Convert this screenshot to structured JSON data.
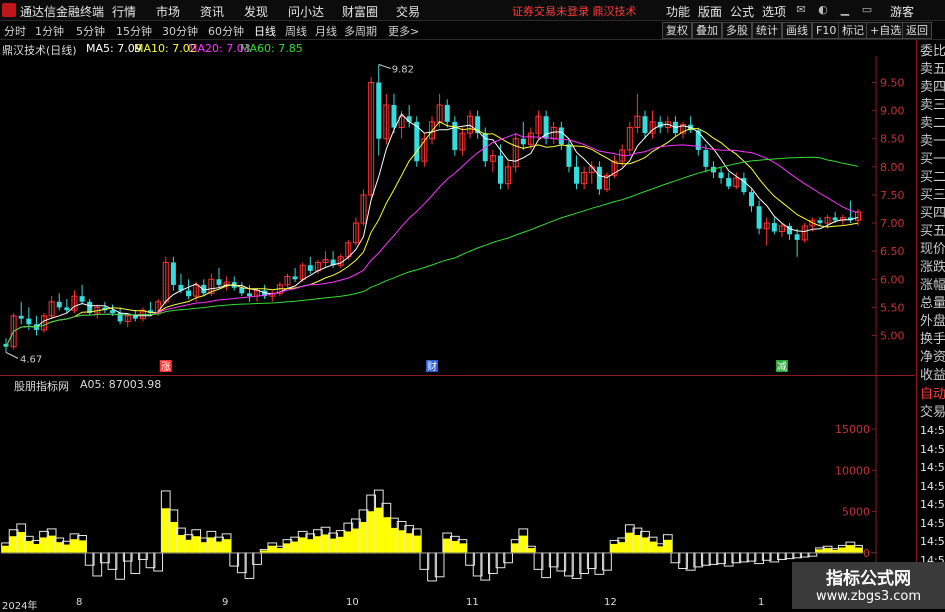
{
  "app": {
    "name": "通达信金融终端",
    "menu": [
      "行情",
      "市场",
      "资讯",
      "发现",
      "问小达",
      "财富圈",
      "交易"
    ],
    "notice": "证券交易未登录   鼎汉技术",
    "right_menu": [
      "功能",
      "版面",
      "公式",
      "选项"
    ],
    "guest": "游客"
  },
  "toolbar": {
    "periods": [
      "分时",
      "1分钟",
      "5分钟",
      "15分钟",
      "30分钟",
      "60分钟",
      "日线",
      "周线",
      "月线",
      "多周期",
      "更多>"
    ],
    "active_period": "日线",
    "buttons": [
      "复权",
      "叠加",
      "多股",
      "统计",
      "画线",
      "F10",
      "标记",
      "+自选",
      "返回"
    ]
  },
  "main_chart": {
    "title": "鼎汉技术(日线)",
    "ma": [
      {
        "label": "MA5: 7.09",
        "color": "#ffffff"
      },
      {
        "label": "MA10: 7.02",
        "color": "#ffff33"
      },
      {
        "label": "MA20: 7.03",
        "color": "#ff33ff"
      },
      {
        "label": "MA60: 7.85",
        "color": "#33dd33"
      }
    ],
    "high_label": "9.82",
    "low_label": "4.67",
    "markers": [
      "涨",
      "财",
      "减"
    ],
    "y_ticks": [
      "9.50",
      "9.00",
      "8.50",
      "8.00",
      "7.50",
      "7.00",
      "6.50",
      "6.00",
      "5.50",
      "5.00"
    ]
  },
  "indicator": {
    "name": "股朋指标网",
    "value_label": "A05: 87003.98",
    "y_ticks": [
      "15000",
      "10000",
      "5000",
      "0"
    ]
  },
  "x_axis": [
    "2024年",
    "8",
    "9",
    "10",
    "11",
    "12",
    "1"
  ],
  "right_labels": [
    "委比",
    "卖五",
    "卖四",
    "卖三",
    "卖二",
    "卖一",
    "买一",
    "买二",
    "买三",
    "买四",
    "买五",
    "现价",
    "涨跌",
    "涨幅",
    "总量",
    "外盘",
    "换手",
    "净资",
    "收益"
  ],
  "right_lower": {
    "tab1": "自动",
    "tab2": "交易",
    "times": [
      "14:56",
      "14:56",
      "14:56",
      "14:56",
      "14:56",
      "14:56",
      "14:56",
      "14:56",
      "14:56",
      "14:56"
    ]
  },
  "watermark": {
    "line1": "指标公式网",
    "line2": "www.zbgs3.com"
  },
  "chart_data": {
    "type": "candlestick",
    "price_ylim": [
      4.6,
      9.9
    ],
    "indicator_ylim": [
      -4500,
      19000
    ],
    "candles": [
      [
        4.85,
        4.95,
        4.7,
        4.8
      ],
      [
        4.8,
        5.4,
        4.75,
        5.35
      ],
      [
        5.35,
        5.6,
        5.2,
        5.3
      ],
      [
        5.3,
        5.5,
        5.1,
        5.2
      ],
      [
        5.2,
        5.35,
        5.0,
        5.1
      ],
      [
        5.1,
        5.4,
        5.05,
        5.35
      ],
      [
        5.35,
        5.7,
        5.3,
        5.6
      ],
      [
        5.6,
        5.75,
        5.45,
        5.5
      ],
      [
        5.5,
        5.65,
        5.4,
        5.45
      ],
      [
        5.45,
        5.8,
        5.4,
        5.7
      ],
      [
        5.7,
        5.9,
        5.55,
        5.6
      ],
      [
        5.6,
        5.65,
        5.35,
        5.4
      ],
      [
        5.4,
        5.55,
        5.3,
        5.5
      ],
      [
        5.5,
        5.6,
        5.4,
        5.45
      ],
      [
        5.45,
        5.55,
        5.35,
        5.4
      ],
      [
        5.4,
        5.5,
        5.2,
        5.25
      ],
      [
        5.25,
        5.4,
        5.15,
        5.35
      ],
      [
        5.35,
        5.45,
        5.25,
        5.3
      ],
      [
        5.3,
        5.5,
        5.25,
        5.45
      ],
      [
        5.45,
        5.6,
        5.35,
        5.4
      ],
      [
        5.4,
        5.65,
        5.35,
        5.6
      ],
      [
        5.6,
        6.4,
        5.55,
        6.3
      ],
      [
        6.3,
        6.4,
        5.8,
        5.9
      ],
      [
        5.9,
        6.1,
        5.75,
        5.8
      ],
      [
        5.8,
        6.0,
        5.65,
        5.7
      ],
      [
        5.7,
        5.95,
        5.6,
        5.9
      ],
      [
        5.9,
        6.0,
        5.7,
        5.75
      ],
      [
        5.75,
        6.1,
        5.7,
        6.0
      ],
      [
        6.0,
        6.2,
        5.85,
        5.9
      ],
      [
        5.9,
        6.05,
        5.8,
        5.95
      ],
      [
        5.95,
        6.05,
        5.8,
        5.85
      ],
      [
        5.85,
        5.95,
        5.7,
        5.75
      ],
      [
        5.75,
        5.9,
        5.6,
        5.7
      ],
      [
        5.7,
        5.85,
        5.6,
        5.8
      ],
      [
        5.8,
        5.9,
        5.65,
        5.7
      ],
      [
        5.7,
        5.8,
        5.6,
        5.75
      ],
      [
        5.75,
        5.95,
        5.7,
        5.9
      ],
      [
        5.9,
        6.1,
        5.85,
        6.05
      ],
      [
        6.05,
        6.2,
        5.95,
        6.0
      ],
      [
        6.0,
        6.3,
        5.95,
        6.25
      ],
      [
        6.25,
        6.4,
        6.1,
        6.15
      ],
      [
        6.15,
        6.35,
        6.1,
        6.3
      ],
      [
        6.3,
        6.5,
        6.2,
        6.35
      ],
      [
        6.35,
        6.5,
        6.2,
        6.25
      ],
      [
        6.25,
        6.45,
        6.2,
        6.4
      ],
      [
        6.4,
        6.7,
        6.35,
        6.65
      ],
      [
        6.65,
        7.1,
        6.6,
        7.0
      ],
      [
        7.0,
        7.6,
        6.95,
        7.5
      ],
      [
        7.5,
        9.6,
        7.45,
        9.5
      ],
      [
        9.5,
        9.82,
        8.2,
        8.5
      ],
      [
        8.5,
        9.3,
        8.4,
        9.1
      ],
      [
        9.1,
        9.3,
        8.6,
        8.7
      ],
      [
        8.7,
        9.0,
        8.5,
        8.9
      ],
      [
        8.9,
        9.1,
        8.7,
        8.8
      ],
      [
        8.8,
        8.9,
        8.0,
        8.1
      ],
      [
        8.1,
        8.6,
        8.0,
        8.5
      ],
      [
        8.5,
        8.9,
        8.4,
        8.8
      ],
      [
        8.8,
        9.3,
        8.7,
        9.1
      ],
      [
        9.1,
        9.2,
        8.7,
        8.8
      ],
      [
        8.8,
        8.9,
        8.2,
        8.3
      ],
      [
        8.3,
        8.7,
        8.2,
        8.6
      ],
      [
        8.6,
        9.0,
        8.5,
        8.9
      ],
      [
        8.9,
        9.0,
        8.5,
        8.6
      ],
      [
        8.6,
        8.7,
        8.0,
        8.1
      ],
      [
        8.1,
        8.3,
        7.9,
        8.2
      ],
      [
        8.2,
        8.4,
        7.6,
        7.7
      ],
      [
        7.7,
        8.1,
        7.6,
        8.0
      ],
      [
        8.0,
        8.6,
        7.9,
        8.5
      ],
      [
        8.5,
        8.8,
        8.3,
        8.4
      ],
      [
        8.4,
        8.7,
        8.3,
        8.6
      ],
      [
        8.6,
        9.0,
        8.5,
        8.9
      ],
      [
        8.9,
        9.0,
        8.4,
        8.5
      ],
      [
        8.5,
        8.8,
        8.4,
        8.7
      ],
      [
        8.7,
        8.8,
        8.3,
        8.4
      ],
      [
        8.4,
        8.5,
        7.9,
        8.0
      ],
      [
        8.0,
        8.2,
        7.6,
        7.7
      ],
      [
        7.7,
        8.0,
        7.6,
        7.9
      ],
      [
        7.9,
        8.1,
        7.7,
        8.0
      ],
      [
        8.0,
        8.1,
        7.5,
        7.6
      ],
      [
        7.6,
        7.9,
        7.55,
        7.85
      ],
      [
        7.85,
        8.2,
        7.8,
        8.1
      ],
      [
        8.1,
        8.4,
        8.0,
        8.3
      ],
      [
        8.3,
        8.8,
        8.2,
        8.7
      ],
      [
        8.7,
        9.3,
        8.6,
        8.9
      ],
      [
        8.9,
        9.0,
        8.5,
        8.6
      ],
      [
        8.6,
        9.0,
        8.5,
        8.8
      ],
      [
        8.8,
        8.9,
        8.6,
        8.7
      ],
      [
        8.7,
        8.9,
        8.6,
        8.8
      ],
      [
        8.8,
        8.9,
        8.55,
        8.6
      ],
      [
        8.6,
        8.8,
        8.5,
        8.75
      ],
      [
        8.75,
        8.9,
        8.6,
        8.65
      ],
      [
        8.65,
        8.7,
        8.2,
        8.3
      ],
      [
        8.3,
        8.4,
        7.9,
        8.0
      ],
      [
        8.0,
        8.1,
        7.8,
        7.9
      ],
      [
        7.9,
        8.0,
        7.7,
        7.8
      ],
      [
        7.8,
        7.9,
        7.6,
        7.65
      ],
      [
        7.65,
        7.9,
        7.6,
        7.8
      ],
      [
        7.8,
        7.9,
        7.5,
        7.55
      ],
      [
        7.55,
        7.6,
        7.2,
        7.3
      ],
      [
        7.3,
        7.4,
        6.8,
        6.9
      ],
      [
        6.9,
        7.1,
        6.6,
        7.0
      ],
      [
        7.0,
        7.1,
        6.8,
        6.85
      ],
      [
        6.85,
        7.0,
        6.75,
        6.95
      ],
      [
        6.95,
        7.0,
        6.7,
        6.8
      ],
      [
        6.8,
        6.9,
        6.4,
        6.7
      ],
      [
        6.7,
        7.0,
        6.65,
        6.95
      ],
      [
        6.95,
        7.1,
        6.85,
        7.05
      ],
      [
        7.05,
        7.1,
        6.95,
        7.0
      ],
      [
        7.0,
        7.15,
        6.9,
        7.1
      ],
      [
        7.1,
        7.2,
        7.0,
        7.05
      ],
      [
        7.05,
        7.15,
        6.95,
        7.1
      ],
      [
        7.1,
        7.4,
        7.0,
        7.05
      ],
      [
        7.05,
        7.25,
        6.95,
        7.2
      ]
    ],
    "indicator_values": [
      1200,
      2800,
      3500,
      2000,
      1500,
      2600,
      2900,
      1800,
      1400,
      2300,
      2100,
      -1500,
      -2800,
      -1200,
      -2000,
      -3200,
      -1000,
      -2500,
      -800,
      -1800,
      -2200,
      7500,
      5200,
      3000,
      2200,
      2800,
      1800,
      2600,
      1900,
      2300,
      -1600,
      -2400,
      -3100,
      -1400,
      400,
      1200,
      800,
      1600,
      1900,
      2600,
      2300,
      2800,
      3100,
      2400,
      2700,
      3600,
      4100,
      5200,
      7000,
      7600,
      6000,
      4200,
      3800,
      3300,
      2900,
      -2000,
      -3400,
      -2900,
      2400,
      2000,
      1600,
      -1500,
      -2800,
      -3300,
      -2500,
      -1800,
      -1200,
      1600,
      2900,
      800,
      -2000,
      -3000,
      -1700,
      -2200,
      -2800,
      -3100,
      -2500,
      -1900,
      -2600,
      -2100,
      1500,
      1800,
      3400,
      3000,
      2600,
      1900,
      1100,
      2200,
      -1200,
      -1900,
      -2100,
      -1700,
      -1500,
      -1400,
      -1300,
      -1600,
      -1200,
      -1100,
      -1000,
      -1300,
      -900,
      -1100,
      -800,
      -700,
      -600,
      -500,
      -400,
      600,
      800,
      500,
      900,
      1300,
      900
    ]
  }
}
